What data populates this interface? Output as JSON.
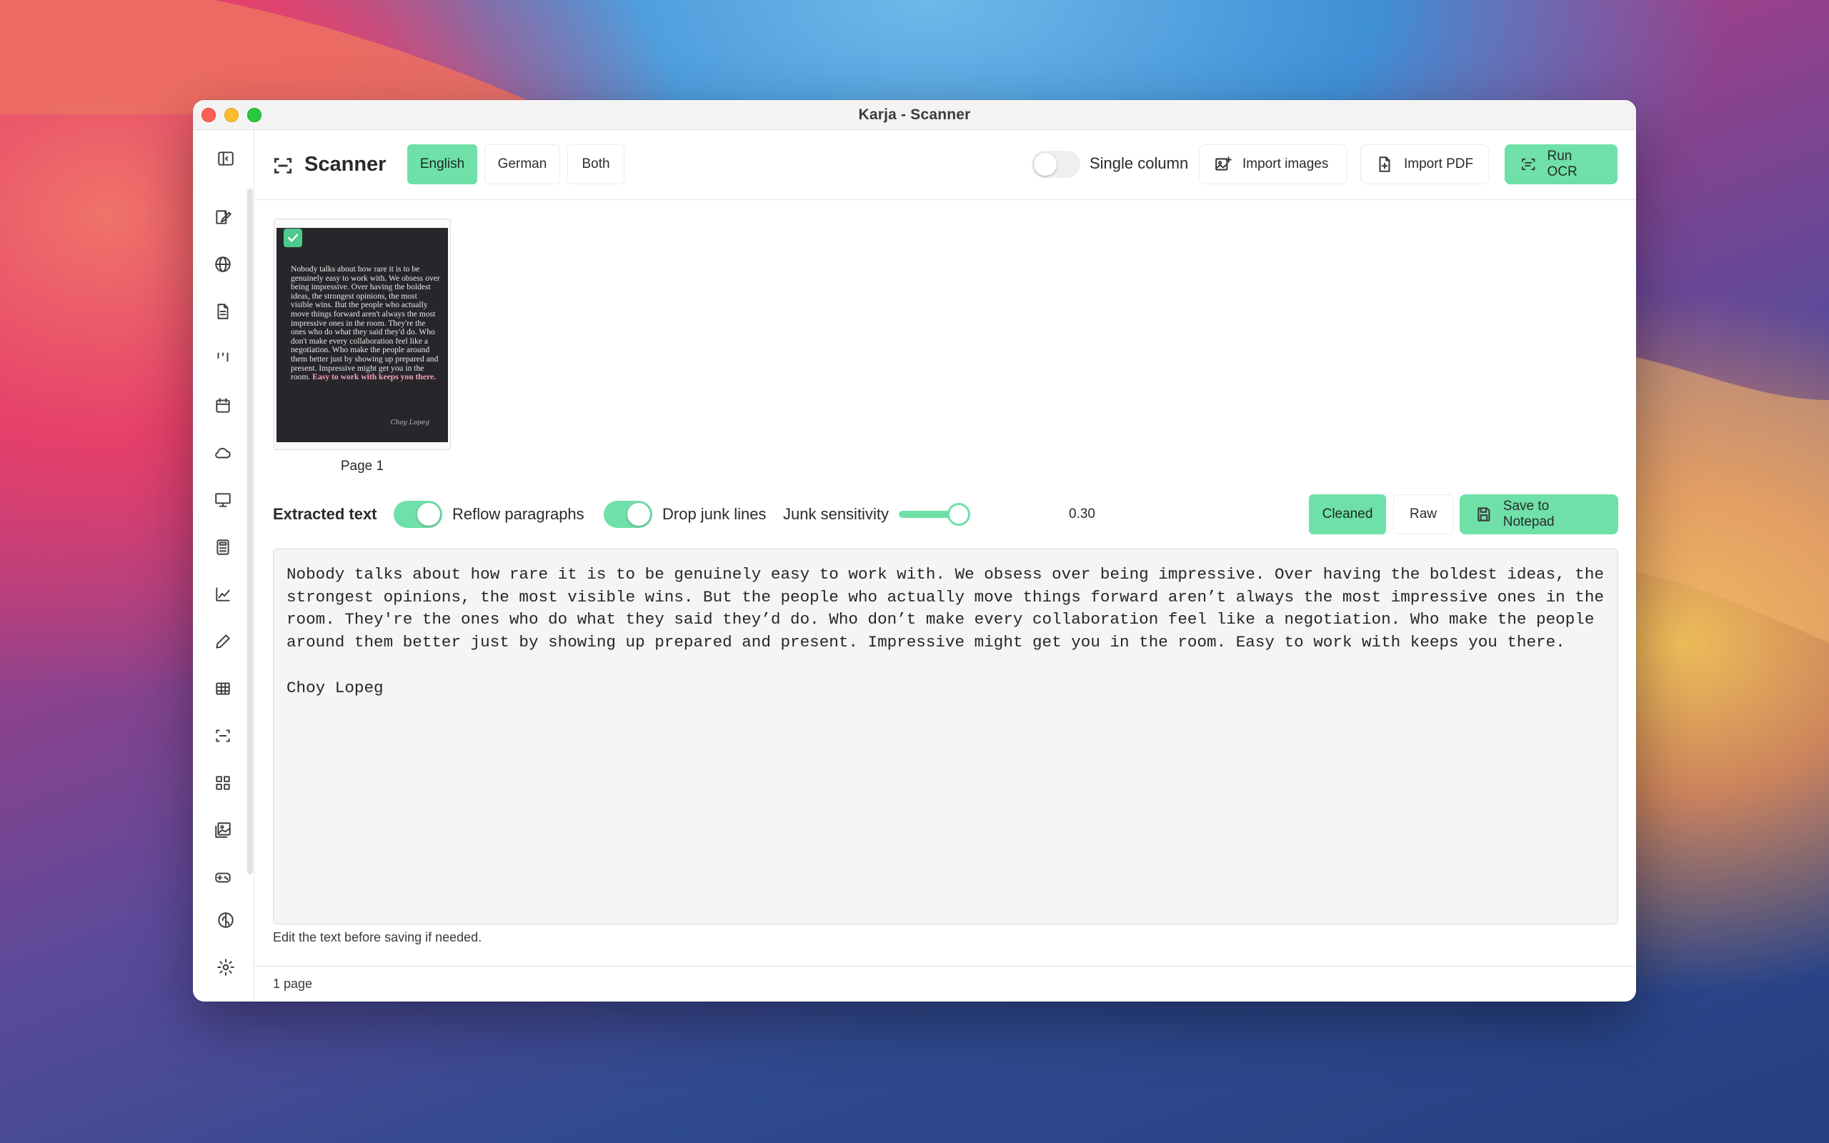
{
  "window": {
    "title": "Karja - Scanner"
  },
  "toolbar": {
    "page_title": "Scanner",
    "languages": [
      "English",
      "German",
      "Both"
    ],
    "active_language": "English",
    "single_column_label": "Single column",
    "single_column_on": false,
    "import_images_label": "Import images",
    "import_pdf_label": "Import PDF",
    "run_ocr_label": "Run OCR"
  },
  "sidebar": {
    "icons": [
      "sidebar-toggle-icon",
      "notepad-icon",
      "globe-icon",
      "document-icon",
      "kanban-icon",
      "calendar-icon",
      "cloud-icon",
      "presentation-icon",
      "calculator-icon",
      "chart-icon",
      "pencil-icon",
      "table-icon",
      "scanner-icon",
      "apps-grid-icon",
      "image-gallery-icon",
      "gamepad-icon",
      "brain-icon",
      "settings-icon"
    ]
  },
  "pages": [
    {
      "caption": "Page 1",
      "selected": true,
      "image_text": "Nobody talks about how rare it is to be genuinely easy to work with. We obsess over being impressive. Over having the boldest ideas, the strongest opinions, the most visible wins. But the people who actually move things forward aren't always the most impressive ones in the room. They're the ones who do what they said they'd do. Who don't make every collaboration feel like a negotiation. Who make the people around them better just by showing up prepared and present. Impressive might get you in the room.",
      "image_highlight": "Easy to work with keeps you there.",
      "image_signature": "Choy Lopeg"
    }
  ],
  "extract": {
    "heading": "Extracted text",
    "reflow_label": "Reflow paragraphs",
    "reflow_on": true,
    "drop_junk_label": "Drop junk lines",
    "drop_junk_on": true,
    "sensitivity_label": "Junk sensitivity",
    "sensitivity_value": "0.30",
    "cleaned_label": "Cleaned",
    "raw_label": "Raw",
    "active_view": "Cleaned",
    "save_label": "Save to Notepad",
    "text": "Nobody talks about how rare it is to be genuinely easy to work with. We obsess over being impressive. Over having the boldest ideas, the strongest opinions, the most visible wins. But the people who actually move things forward aren’t always the most impressive ones in the room. They're the ones who do what they said they’d do. Who don’t make every collaboration feel like a negotiation. Who make the people around them better just by showing up prepared and present. Impressive might get you in the room. Easy to work with keeps you there.\n\nChoy Lopeg",
    "hint": "Edit the text before saving if needed."
  },
  "status": {
    "page_count": "1 page"
  },
  "colors": {
    "accent": "#6ee0a8",
    "check": "#4cc98c"
  }
}
